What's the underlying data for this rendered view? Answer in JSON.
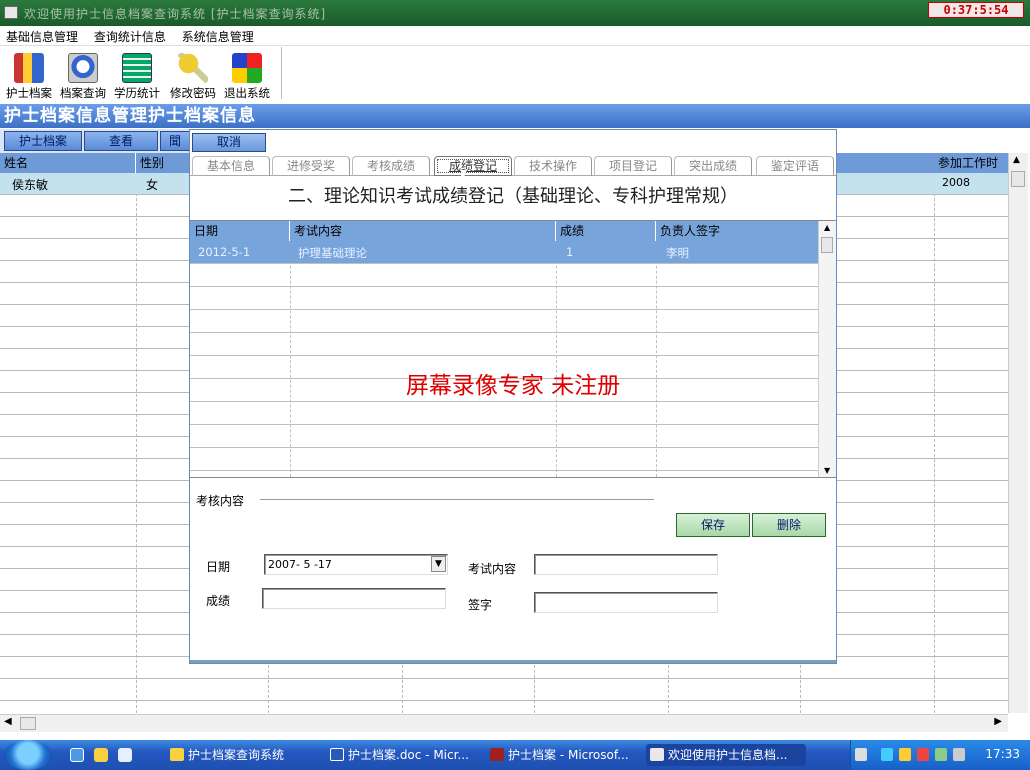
{
  "window": {
    "title": "欢迎使用护士信息档案查询系统 [护士档案查询系统]",
    "clock": "0:37:5:54"
  },
  "menu": [
    "基础信息管理",
    "查询统计信息",
    "系统信息管理"
  ],
  "toolbar": [
    {
      "label": "护士档案",
      "icon": "nurse-record-icon"
    },
    {
      "label": "档案查询",
      "icon": "record-query-icon"
    },
    {
      "label": "学历统计",
      "icon": "education-stats-icon"
    },
    {
      "label": "修改密码",
      "icon": "key-icon"
    },
    {
      "label": "退出系统",
      "icon": "exit-icon"
    }
  ],
  "section_title": "护士档案信息管理护士档案信息",
  "buttons": {
    "record": "护士档案",
    "view": "查看",
    "partial": "聞"
  },
  "grid": {
    "headers": [
      "姓名",
      "性别",
      "参加工作时间"
    ],
    "row": {
      "name": "侯东敏",
      "gender": "女",
      "start_year": "2008"
    }
  },
  "dialog": {
    "cancel": "取消",
    "tabs": [
      "基本信息",
      "进修受奖",
      "考核成绩",
      "成绩登记",
      "技术操作",
      "项目登记",
      "突出成绩",
      "鉴定评语"
    ],
    "active_tab": 3,
    "heading": "二、理论知识考试成绩登记（基础理论、专科护理常规）",
    "table": {
      "headers": [
        "日期",
        "考试内容",
        "成绩",
        "负责人签字"
      ],
      "row": [
        "2012-5-1",
        "护理基础理论",
        "1",
        "李明"
      ]
    },
    "watermark": "屏幕录像专家  未注册",
    "form": {
      "group_label": "考核内容",
      "save": "保存",
      "delete": "删除",
      "date_label": "日期",
      "date_value": "2007- 5 -17",
      "exam_label": "考试内容",
      "exam_value": "",
      "score_label": "成绩",
      "score_value": "",
      "sign_label": "签字",
      "sign_value": ""
    }
  },
  "taskbar": {
    "tasks": [
      "护士档案查询系统",
      "护士档案.doc - Micr...",
      "护士档案 - Microsof...",
      "欢迎使用护士信息档..."
    ],
    "time": "17:33"
  },
  "colors": {
    "header_blue": "#3c70c8",
    "grid_header": "#6e9bd8",
    "watermark": "#e00000",
    "taskbar": "#2458c0"
  }
}
